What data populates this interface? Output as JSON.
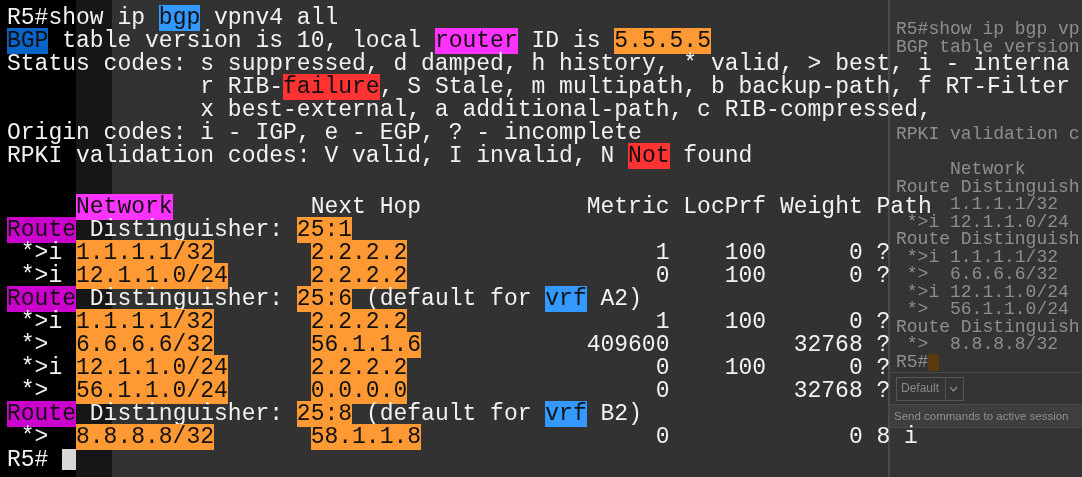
{
  "terminal": {
    "intro_lines": [
      [
        {
          "t": "R5#show ip "
        },
        {
          "t": "bgp",
          "color": "#3399ff"
        },
        {
          "t": " vpnv4 all"
        }
      ],
      [
        {
          "t": "BGP",
          "color": "#0a64c8"
        },
        {
          "t": " table version is 10, local "
        },
        {
          "t": "router",
          "color": "#ff33ff"
        },
        {
          "t": " ID is "
        },
        {
          "t": "5.5.5.5",
          "color": "#ff9933"
        }
      ],
      [
        {
          "t": "Status codes: s suppressed, d damped, h history, * valid, > best, i - interna"
        }
      ],
      [
        {
          "t": "              r RIB-"
        },
        {
          "t": "failure",
          "color": "#ff3333"
        },
        {
          "t": ", S Stale, m multipath, b backup-path, f RT-Filter"
        }
      ],
      [
        {
          "t": "              x best-external, a additional-path, c RIB-compressed,"
        }
      ],
      [
        {
          "t": "Origin codes: i - IGP, e - EGP, ? - incomplete"
        }
      ],
      [
        {
          "t": "RPKI validation codes: V valid, I invalid, N "
        },
        {
          "t": "Not",
          "color": "#ff3333"
        },
        {
          "t": " found"
        }
      ]
    ],
    "table_lines": [
      {
        "kind": "header",
        "segments": [
          {
            "t": "Network",
            "color": "#ff33ff"
          },
          {
            "t": "          Next Hop            Metric LocPrf Weight Path"
          }
        ]
      },
      {
        "kind": "rd",
        "segments": [
          {
            "t": "Route",
            "color": "#cc00cc"
          },
          {
            "t": " Distinguisher: "
          },
          {
            "t": "25:1",
            "color": "#ff9933"
          }
        ]
      },
      {
        "kind": "route",
        "status": "*>i",
        "network": "1.1.1.1/32",
        "next_hop": "2.2.2.2",
        "color": "#ff9933",
        "metric": "1",
        "locprf": "100",
        "weight": "0",
        "path": "?"
      },
      {
        "kind": "route",
        "status": "*>i",
        "network": "12.1.1.0/24",
        "next_hop": "2.2.2.2",
        "color": "#ff9933",
        "metric": "0",
        "locprf": "100",
        "weight": "0",
        "path": "?"
      },
      {
        "kind": "rd",
        "segments": [
          {
            "t": "Route",
            "color": "#cc00cc"
          },
          {
            "t": " Distinguisher: "
          },
          {
            "t": "25:6",
            "color": "#ff9933"
          },
          {
            "t": " (default for "
          },
          {
            "t": "vrf",
            "color": "#3399ff"
          },
          {
            "t": " A2)"
          }
        ]
      },
      {
        "kind": "route",
        "status": "*>i",
        "network": "1.1.1.1/32",
        "next_hop": "2.2.2.2",
        "color": "#ff9933",
        "metric": "1",
        "locprf": "100",
        "weight": "0",
        "path": "?"
      },
      {
        "kind": "route",
        "status": "*>",
        "network": "6.6.6.6/32",
        "next_hop": "56.1.1.6",
        "color": "#ff9933",
        "metric": "409600",
        "weight": "32768",
        "path": "?"
      },
      {
        "kind": "route",
        "status": "*>i",
        "network": "12.1.1.0/24",
        "next_hop": "2.2.2.2",
        "color": "#ff9933",
        "metric": "0",
        "locprf": "100",
        "weight": "0",
        "path": "?"
      },
      {
        "kind": "route",
        "status": "*>",
        "network": "56.1.1.0/24",
        "next_hop": "0.0.0.0",
        "color": "#ff9933",
        "metric": "0",
        "weight": "32768",
        "path": "?"
      },
      {
        "kind": "rd",
        "segments": [
          {
            "t": "Route",
            "color": "#cc00cc"
          },
          {
            "t": " Distinguisher: "
          },
          {
            "t": "25:8",
            "color": "#ff9933"
          },
          {
            "t": " (default for "
          },
          {
            "t": "vrf",
            "color": "#3399ff"
          },
          {
            "t": " B2)"
          }
        ]
      },
      {
        "kind": "route",
        "status": "*>",
        "network": "8.8.8.8/32",
        "next_hop": "58.1.1.8",
        "color": "#ff9933",
        "metric": "0",
        "weight": "0",
        "path": "8 i"
      }
    ],
    "prompt": "R5#",
    "cursor": true
  },
  "session_panel": {
    "top_lines": [
      "R5#show ip bgp vp",
      "BGP table version"
    ],
    "middle_lines": [
      "RPKI validation c"
    ],
    "lines": [
      {
        "kind": "header",
        "text": "Network"
      },
      {
        "kind": "rd",
        "text": "Route Distinguish"
      },
      {
        "kind": "route",
        "network": "1.1.1.1/32"
      },
      {
        "kind": "route",
        "status": "*>i",
        "network": "12.1.1.0/24"
      },
      {
        "kind": "rd",
        "text": "Route Distinguish"
      },
      {
        "kind": "route",
        "status": "*>i",
        "network": "1.1.1.1/32"
      },
      {
        "kind": "route",
        "status": "*>",
        "network": "6.6.6.6/32"
      },
      {
        "kind": "route",
        "status": "*>i",
        "network": "12.1.1.0/24"
      },
      {
        "kind": "route",
        "status": "*>",
        "network": "56.1.1.0/24"
      },
      {
        "kind": "rd",
        "text": "Route Distinguish"
      },
      {
        "kind": "route",
        "status": "*>",
        "network": "8.8.8.8/32"
      }
    ],
    "prompt": "R5#",
    "cursor": true,
    "session_select": {
      "value": "Default"
    },
    "command_bar": {
      "placeholder": "Send commands to active session"
    }
  }
}
